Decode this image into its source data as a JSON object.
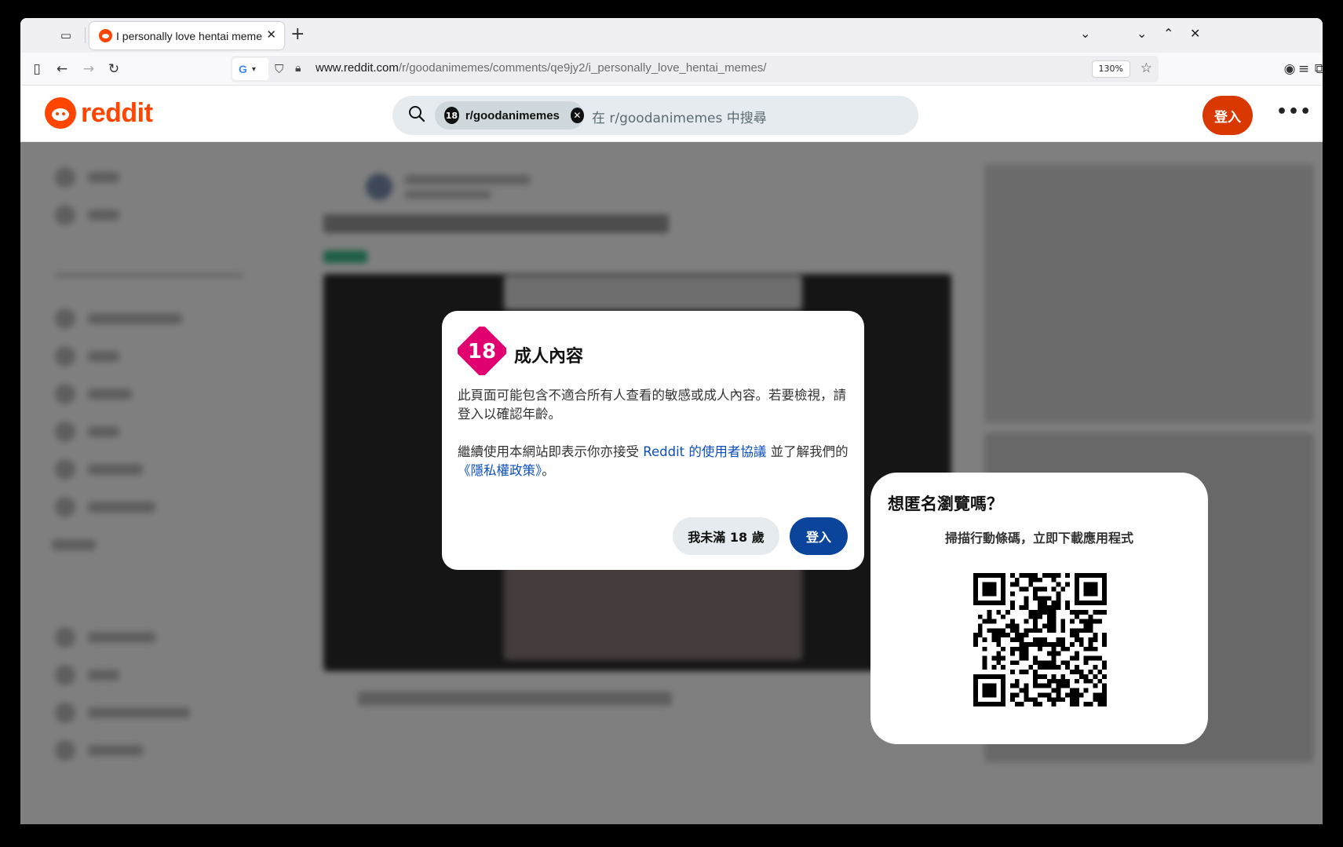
{
  "browser": {
    "tab_title": "I personally love hentai memes",
    "url_host": "www.reddit.com",
    "url_path": "/r/goodanimemes/comments/qe9jy2/i_personally_love_hentai_memes/",
    "zoom": "130%"
  },
  "header": {
    "logo_text": "reddit",
    "search_chip_badge": "18",
    "search_chip_label": "r/goodanimemes",
    "search_placeholder": "在 r/goodanimemes 中搜尋",
    "login_label": "登入"
  },
  "modal": {
    "badge_text": "18",
    "title": "成人內容",
    "body_line1": "此頁面可能包含不適合所有人查看的敏感或成人內容。若要檢視，請登入以確認年齡。",
    "body_p2_prefix": "繼續使用本網站即表示你亦接受 ",
    "user_agreement_link": "Reddit 的使用者協議",
    "body_p2_middle": " 並了解我們的",
    "privacy_link": "《隱私權政策》",
    "body_p2_suffix": "。",
    "under18_label": "我未滿 18 歲",
    "login_label": "登入"
  },
  "qr_card": {
    "title": "想匿名瀏覽嗎？",
    "subtitle": "掃描行動條碼，立即下載應用程式"
  },
  "colors": {
    "reddit_orange": "#ff4500",
    "login_orange": "#d93900",
    "modal_login_blue": "#0a449b",
    "nsfw_pink": "#e0006f",
    "link_blue": "#0b4ebd"
  }
}
